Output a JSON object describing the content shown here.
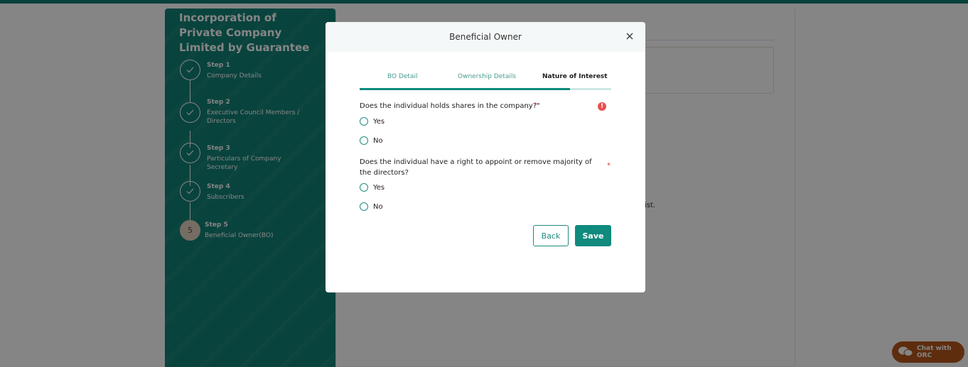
{
  "sidebar": {
    "title": "Incorporation of Private Company Limited by Guarantee",
    "steps": [
      {
        "label": "Step 1",
        "name": "Company Details",
        "status": "done"
      },
      {
        "label": "Step 2",
        "name": "Executive Council Members / Directors",
        "status": "done"
      },
      {
        "label": "Step 3",
        "name": "Particulars of Company Secretary",
        "status": "done"
      },
      {
        "label": "Step 4",
        "name": "Subscribers",
        "status": "done"
      },
      {
        "label": "Step 5",
        "name": "Beneficial Owner(BO)",
        "status": "current",
        "number": "5"
      }
    ]
  },
  "background": {
    "content_fragment": "ist."
  },
  "chat": {
    "label": "Chat with ORC"
  },
  "modal": {
    "title": "Beneficial Owner",
    "tabs": [
      {
        "label": "BO Detail",
        "state": "done"
      },
      {
        "label": "Ownership Details",
        "state": "done"
      },
      {
        "label": "Nature of Interest",
        "state": "active"
      }
    ],
    "progress_fraction": 0.835,
    "questions": [
      {
        "text": "Does the individual holds shares in the company?\"",
        "required_mark": "*",
        "options": [
          "Yes",
          "No"
        ]
      },
      {
        "text": "Does the individual have a right to appoint or remove majority of the directors?",
        "required_mark": "*",
        "options": [
          "Yes",
          "No"
        ]
      }
    ],
    "error_icon": "!",
    "back_label": "Back",
    "save_label": "Save"
  },
  "colors": {
    "primary": "#0f8a7d",
    "sidebar": "#128175",
    "chat": "#b5571b",
    "error": "#ea4f4f"
  }
}
